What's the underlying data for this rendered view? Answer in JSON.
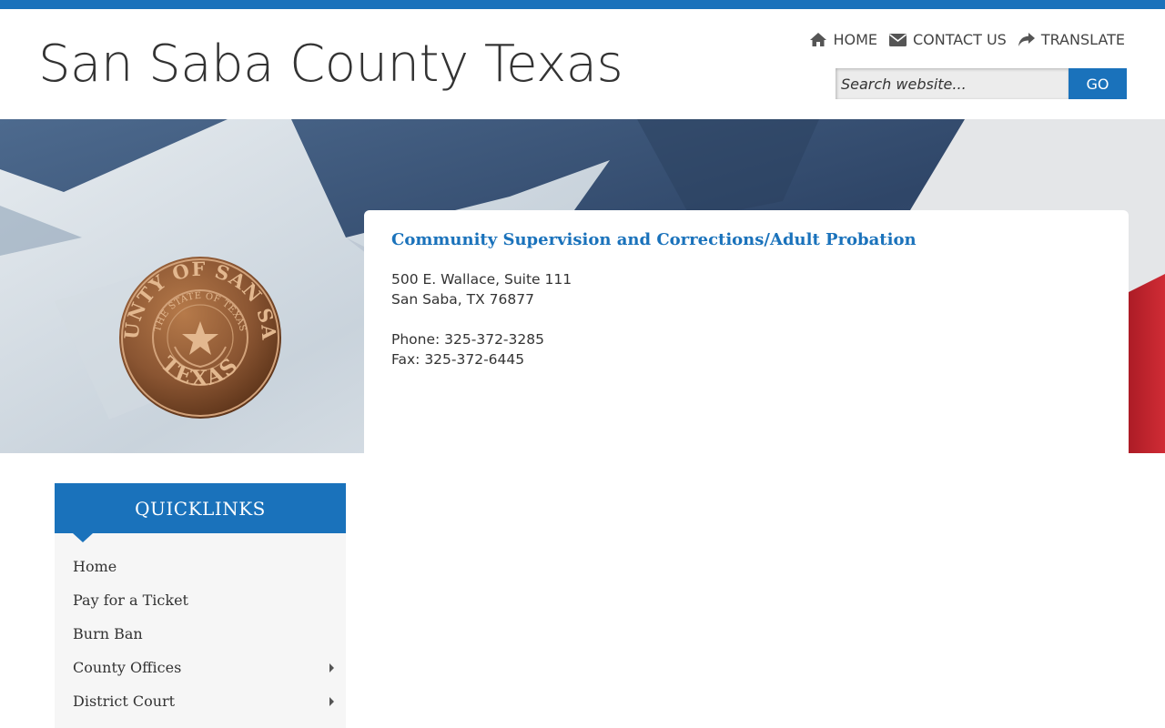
{
  "site": {
    "title": "San Saba County Texas"
  },
  "utility_nav": {
    "home": {
      "label": "HOME",
      "icon": "home-icon"
    },
    "contact": {
      "label": "CONTACT US",
      "icon": "envelope-icon"
    },
    "translate": {
      "label": "TRANSLATE",
      "icon": "share-arrow-icon"
    }
  },
  "search": {
    "placeholder": "Search website...",
    "value": "",
    "button_label": "GO"
  },
  "seal": {
    "outer_text": "COUNTY OF SAN SABA",
    "inner_text": "THE STATE OF TEXAS",
    "bottom_text": "TEXAS"
  },
  "content": {
    "title": "Community Supervision and Corrections/Adult Probation",
    "address_line1": "500 E. Wallace, Suite 111",
    "address_line2": "San Saba, TX 76877",
    "phone": "Phone: 325-372-3285",
    "fax": "Fax: 325-372-6445"
  },
  "quicklinks": {
    "heading": "QUICKLINKS",
    "items": [
      {
        "label": "Home",
        "has_submenu": false
      },
      {
        "label": "Pay for a Ticket",
        "has_submenu": false
      },
      {
        "label": "Burn Ban",
        "has_submenu": false
      },
      {
        "label": "County Offices",
        "has_submenu": true
      },
      {
        "label": "District Court",
        "has_submenu": true
      }
    ]
  },
  "colors": {
    "brand_blue": "#1a72bb",
    "text": "#333333",
    "sidebar_bg": "#f6f6f6"
  }
}
